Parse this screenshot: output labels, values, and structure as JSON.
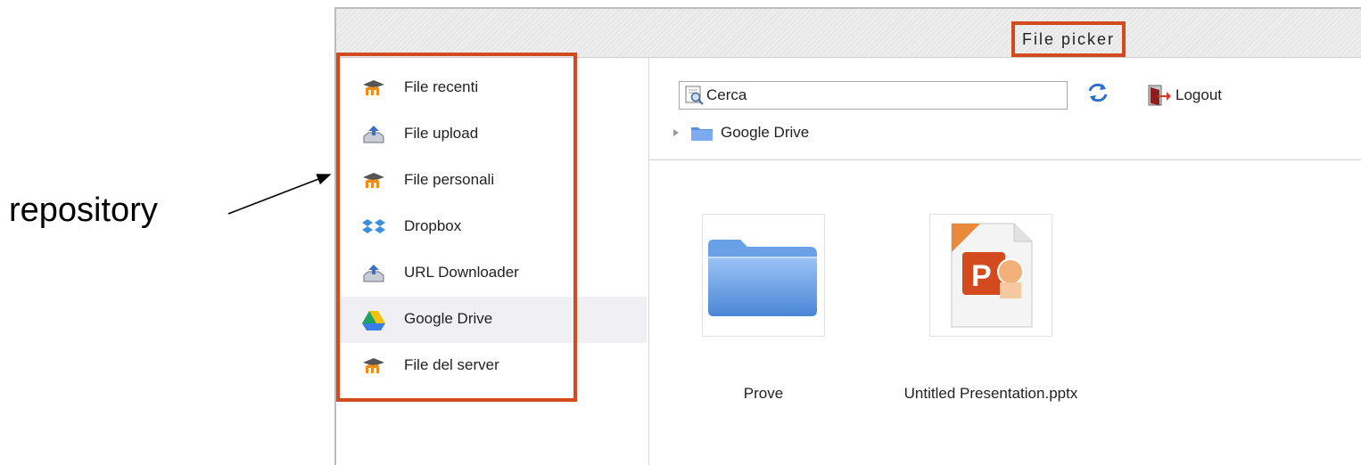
{
  "annotation": {
    "label": "repository"
  },
  "window": {
    "title": "File picker"
  },
  "sidebar": {
    "items": [
      {
        "label": "File recenti",
        "icon": "moodle-icon"
      },
      {
        "label": "File upload",
        "icon": "upload-icon"
      },
      {
        "label": "File personali",
        "icon": "moodle-icon"
      },
      {
        "label": "Dropbox",
        "icon": "dropbox-icon"
      },
      {
        "label": "URL Downloader",
        "icon": "download-icon"
      },
      {
        "label": "Google Drive",
        "icon": "google-drive-icon",
        "active": true
      },
      {
        "label": "File del server",
        "icon": "moodle-icon"
      }
    ]
  },
  "toolbar": {
    "search_placeholder": "Cerca",
    "logout_label": "Logout"
  },
  "breadcrumb": {
    "label": "Google Drive"
  },
  "files": [
    {
      "name": "Prove",
      "type": "folder-icon"
    },
    {
      "name": "Untitled Presentation.pptx",
      "type": "powerpoint-icon"
    }
  ],
  "colors": {
    "highlight": "#d24a1d",
    "active_item": "#f0f0f4"
  }
}
